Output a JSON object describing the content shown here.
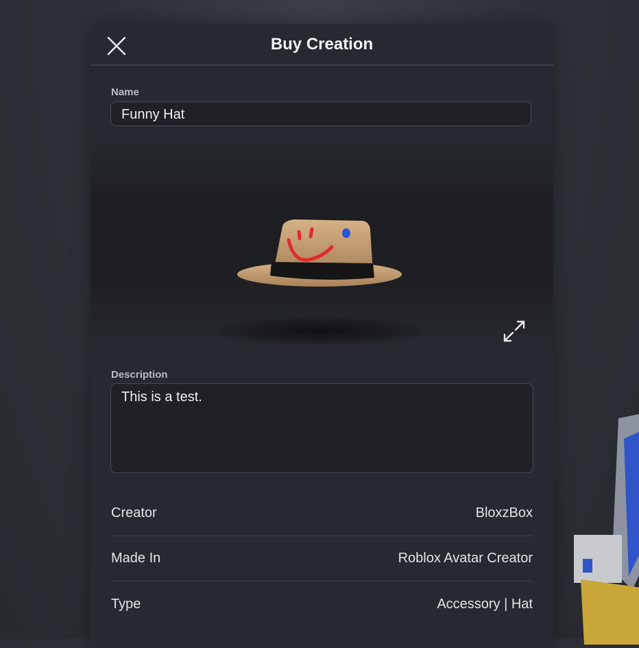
{
  "dialog": {
    "title": "Buy Creation",
    "close_icon": "close-icon"
  },
  "name_field": {
    "label": "Name",
    "value": "Funny Hat"
  },
  "preview": {
    "item_image": "straw-hat-with-smiley",
    "expand_icon": "expand-icon"
  },
  "description_field": {
    "label": "Description",
    "value": "This is a test."
  },
  "details": [
    {
      "label": "Creator",
      "value": "BloxzBox"
    },
    {
      "label": "Made In",
      "value": "Roblox Avatar Creator"
    },
    {
      "label": "Type",
      "value": "Accessory | Hat"
    }
  ],
  "colors": {
    "panel": "#26292f",
    "input_bg": "#1f2126",
    "border": "#474b52"
  }
}
